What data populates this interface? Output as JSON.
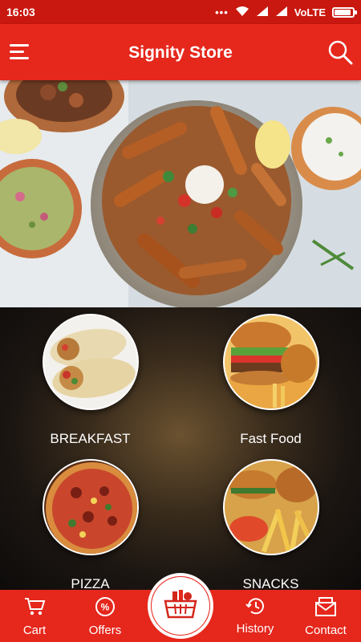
{
  "statusbar": {
    "time": "16:03",
    "dots": "•••",
    "network": "VoLTE",
    "battery_level": 0.85,
    "icons": [
      "wifi-icon",
      "signal-icon",
      "signal-icon",
      "battery-icon"
    ]
  },
  "appbar": {
    "title": "Signity Store",
    "menu_icon": "hamburger-menu-icon",
    "search_icon": "search-icon"
  },
  "hero": {
    "image": "loaded-fries-bowl-photo"
  },
  "categories": [
    {
      "label": "BREAKFAST",
      "image": "breakfast-wrap-photo"
    },
    {
      "label": "Fast Food",
      "image": "burger-photo"
    },
    {
      "label": "PIZZA",
      "image": "pizza-photo"
    },
    {
      "label": "SNACKS",
      "image": "snacks-photo"
    }
  ],
  "bottom_nav": {
    "items": [
      {
        "label": "Cart",
        "icon": "cart-icon"
      },
      {
        "label": "Offers",
        "icon": "offers-icon"
      },
      {
        "label": "History",
        "icon": "history-icon"
      },
      {
        "label": "Contact",
        "icon": "contact-icon"
      }
    ],
    "center_icon": "grocery-basket-icon"
  },
  "colors": {
    "primary": "#e5271c",
    "status_bar": "#c9180f",
    "text_light": "#ffffff"
  }
}
